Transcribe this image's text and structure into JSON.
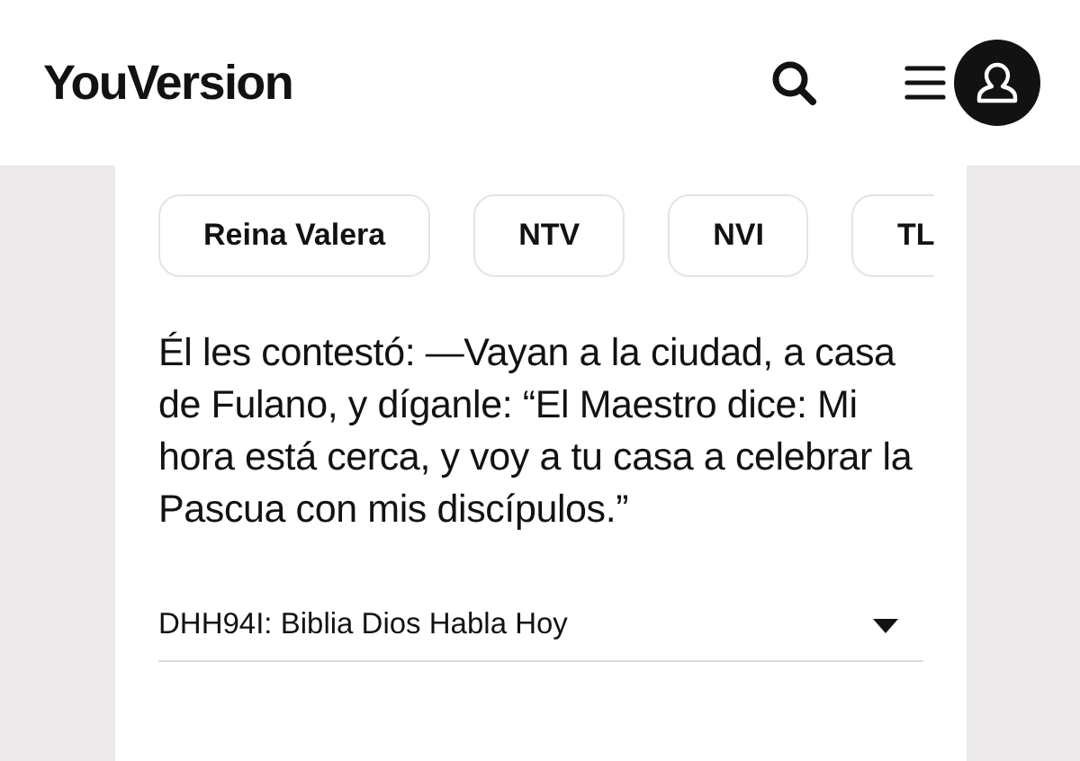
{
  "header": {
    "logo": "YouVersion"
  },
  "versions": [
    "Reina Valera",
    "NTV",
    "NVI",
    "TL"
  ],
  "verse": "Él les contestó: —Vayan a la ciudad, a casa de Fulano, y díganle: “El Maestro dice: Mi hora está cerca, y voy a tu casa a celebrar la Pascua con mis discípulos.”",
  "version_select": {
    "value": "DHH94I: Biblia Dios Habla Hoy"
  }
}
